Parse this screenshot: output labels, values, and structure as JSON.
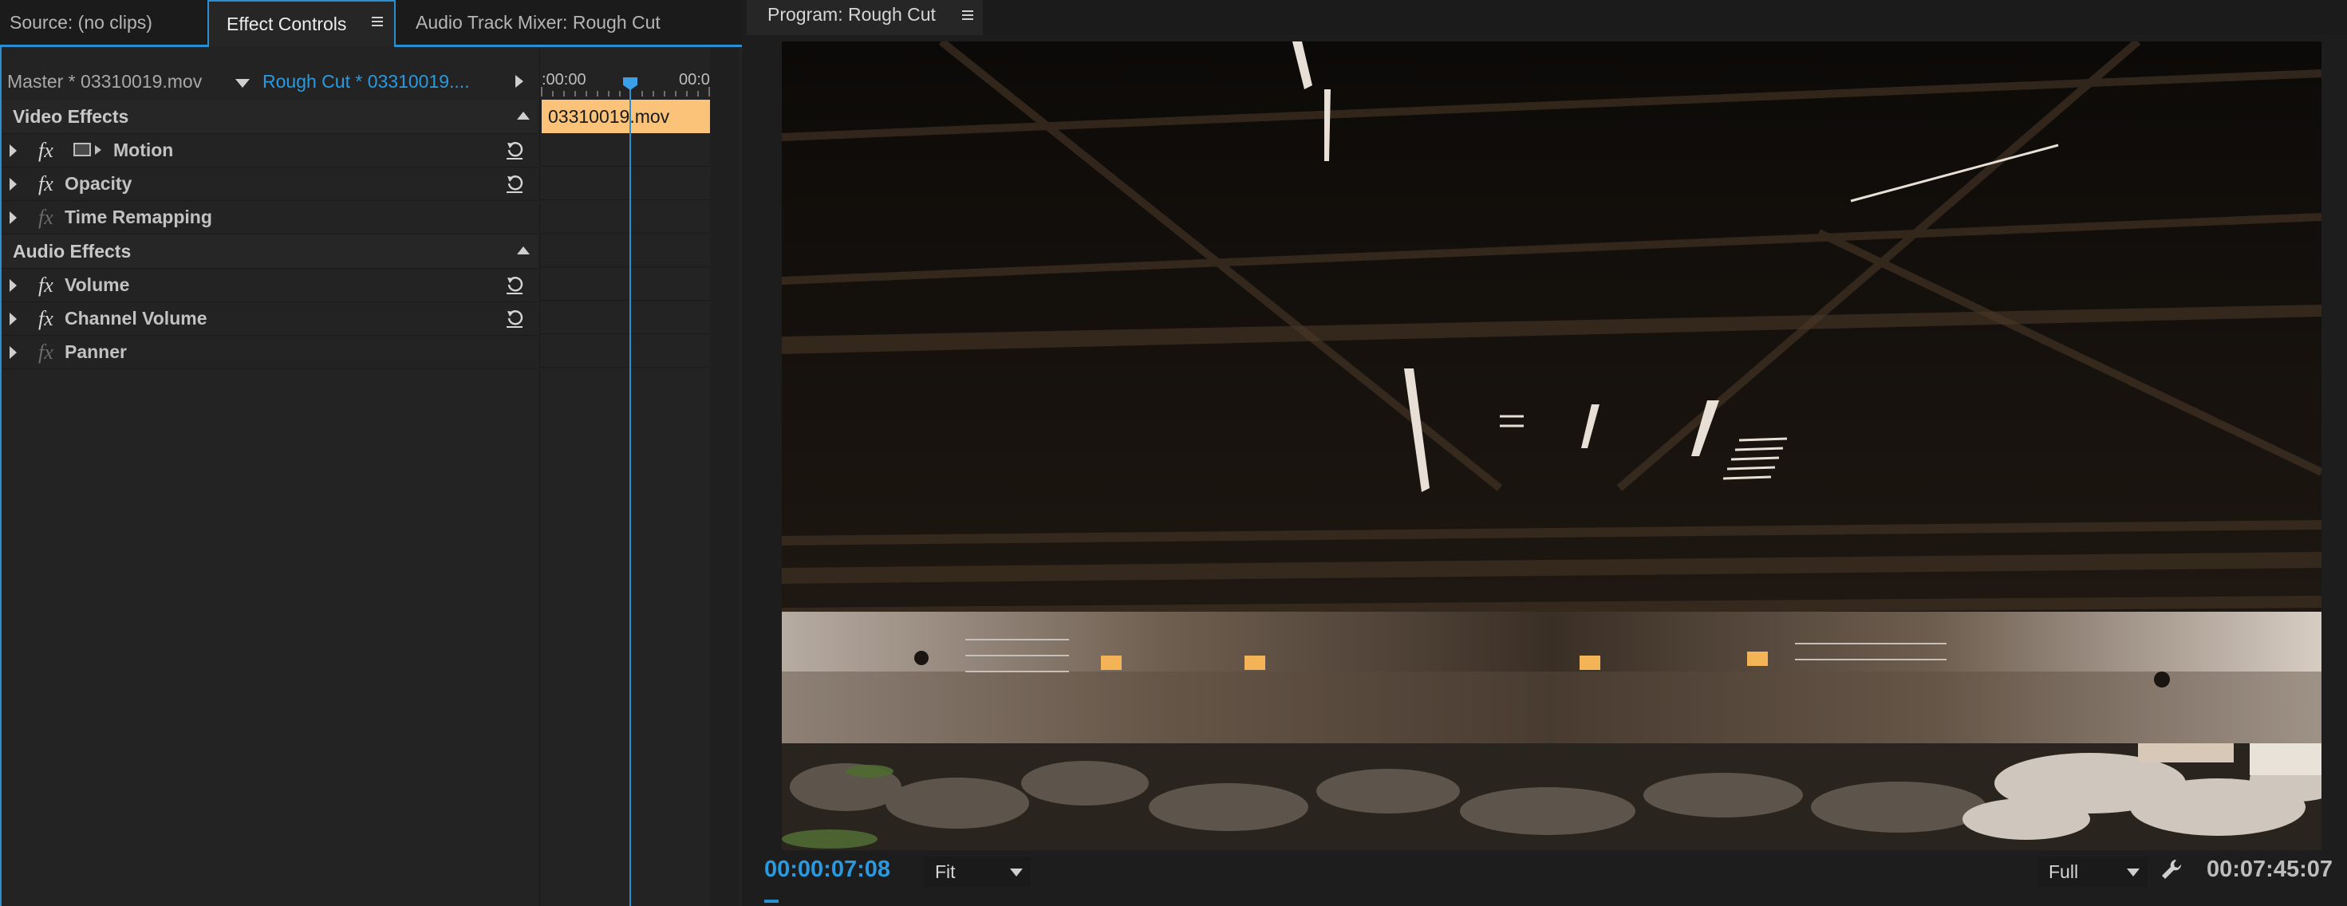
{
  "left_panel": {
    "tabs": [
      {
        "label": "Source: (no clips)"
      },
      {
        "label": "Effect Controls"
      },
      {
        "label": "Audio Track Mixer: Rough Cut"
      }
    ],
    "source_bar": {
      "master_clip": "Master * 03310019.mov",
      "sequence_clip": "Rough Cut * 03310019...."
    },
    "ruler": {
      "start": ":00:00",
      "end": "00:0"
    },
    "clip_label": "03310019.mov",
    "video_effects": {
      "header": "Video Effects",
      "items": [
        {
          "label": "Motion",
          "fx": "fx",
          "enabled": true,
          "resettable": true
        },
        {
          "label": "Opacity",
          "fx": "fx",
          "enabled": true,
          "resettable": true
        },
        {
          "label": "Time Remapping",
          "fx": "fx",
          "enabled": false,
          "resettable": false
        }
      ]
    },
    "audio_effects": {
      "header": "Audio Effects",
      "items": [
        {
          "label": "Volume",
          "fx": "fx",
          "enabled": true,
          "resettable": true
        },
        {
          "label": "Channel Volume",
          "fx": "fx",
          "enabled": true,
          "resettable": true
        },
        {
          "label": "Panner",
          "fx": "fx",
          "enabled": false,
          "resettable": false
        }
      ]
    }
  },
  "program_monitor": {
    "tab_label": "Program: Rough Cut",
    "current_timecode": "00:00:07:08",
    "zoom_level": "Fit",
    "playback_resolution": "Full",
    "duration_timecode": "00:07:45:07"
  },
  "colors": {
    "accent": "#2a8fd0",
    "timecode_blue": "#2a9ae0",
    "clip_orange": "#fbc37a"
  }
}
